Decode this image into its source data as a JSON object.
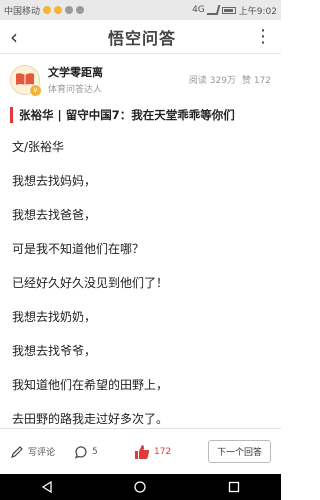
{
  "status_bar": {
    "carrier": "中国移动",
    "time": "上午9:02",
    "network": "4G"
  },
  "top_bar": {
    "logo": "悟空问答",
    "back_icon": "chevron-left-icon",
    "more_icon": "more-dots-icon"
  },
  "author": {
    "name": "文学零距离",
    "tag": "体育问答达人",
    "reads": "阅读 329万",
    "likes": "赞 172"
  },
  "question": {
    "title": "张裕华 | 留守中国7：我在天堂乖乖等你们"
  },
  "content": {
    "paragraphs": [
      "文/张裕华",
      "我想去找妈妈，",
      "我想去找爸爸，",
      "可是我不知道他们在哪？",
      "已经好久好久没见到他们了！",
      "我想去找奶奶，",
      "我想去找爷爷，",
      "我知道他们在希望的田野上，",
      "去田野的路我走过好多次了。"
    ]
  },
  "bottom_bar": {
    "comment_label": "写评论",
    "replies_count": "5",
    "likes_count": "172",
    "next_label": "下一个回答"
  },
  "colors": {
    "accent_red": "#e23a3a",
    "badge_yellow": "#f2b53b"
  }
}
